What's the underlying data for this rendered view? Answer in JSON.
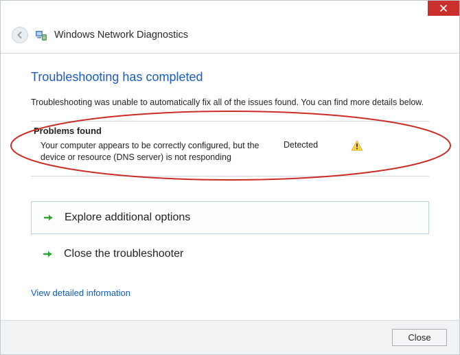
{
  "window": {
    "title": "Windows Network Diagnostics"
  },
  "headline": "Troubleshooting has completed",
  "subtext": "Troubleshooting was unable to automatically fix all of the issues found. You can find more details below.",
  "problems": {
    "header": "Problems found",
    "items": [
      {
        "description": "Your computer appears to be correctly configured, but the device or resource (DNS server) is not responding",
        "status": "Detected",
        "icon": "warning"
      }
    ]
  },
  "options": {
    "explore": "Explore additional options",
    "close": "Close the troubleshooter"
  },
  "link_detail": "View detailed information",
  "footer": {
    "close_button": "Close"
  },
  "colors": {
    "accent": "#1a5bbf",
    "close_bg": "#c9302c",
    "annotation": "#cc2b23"
  }
}
